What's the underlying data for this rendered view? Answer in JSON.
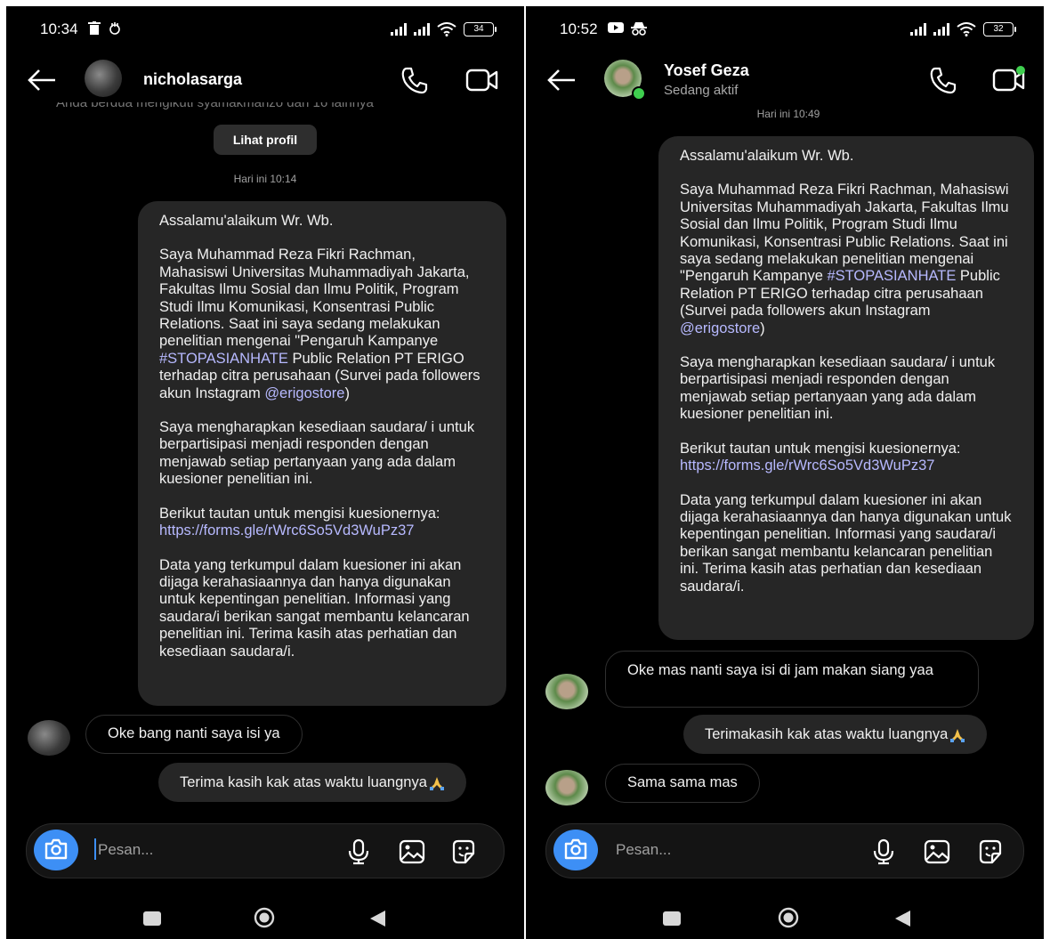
{
  "left": {
    "status": {
      "time": "10:34",
      "battery": "34"
    },
    "contact": {
      "name": "nicholasarga"
    },
    "cutoff_line": "Anda berdua mengikuti syamakmanzo dan 16 lainnya",
    "profile_button": "Lihat profil",
    "timestamp": "Hari ini 10:14",
    "message": {
      "greeting": "Assalamu'alaikum Wr. Wb.",
      "intro_a": "Saya Muhammad Reza Fikri Rachman, Mahasiswi Universitas Muhammadiyah Jakarta, Fakultas Ilmu Sosial dan Ilmu Politik, Program Studi Ilmu Komunikasi, Konsentrasi Public Relations. Saat ini saya sedang melakukan penelitian mengenai \"Pengaruh Kampanye ",
      "hashtag": "#STOPASIANHATE",
      "intro_b": " Public Relation PT ERIGO terhadap citra perusahaan (Survei pada followers akun Instagram ",
      "mention": "@erigostore",
      "intro_c": ")",
      "request": "Saya mengharapkan kesediaan saudara/ i untuk berpartisipasi menjadi responden dengan menjawab setiap pertanyaan yang ada dalam kuesioner penelitian ini.",
      "link_intro": "Berikut tautan untuk mengisi kuesionernya:",
      "link": "https://forms.gle/rWrc6So5Vd3WuPz37",
      "closing": "Data yang terkumpul dalam kuesioner ini akan dijaga kerahasiaannya dan hanya digunakan untuk kepentingan penelitian. Informasi yang saudara/i berikan sangat membantu kelancaran penelitian ini. Terima kasih atas perhatian dan kesediaan saudara/i."
    },
    "reply_1": "Oke bang nanti saya isi ya",
    "sent_2": "Terima kasih kak atas waktu luangnya",
    "composer_placeholder": "Pesan..."
  },
  "right": {
    "status": {
      "time": "10:52",
      "battery": "32"
    },
    "contact": {
      "name": "Yosef Geza",
      "status": "Sedang aktif"
    },
    "timestamp": "Hari ini 10:49",
    "message": {
      "greeting": "Assalamu'alaikum Wr. Wb.",
      "intro_a": "Saya Muhammad Reza Fikri Rachman, Mahasiswi Universitas Muhammadiyah Jakarta, Fakultas Ilmu Sosial dan Ilmu Politik, Program Studi Ilmu Komunikasi, Konsentrasi Public Relations. Saat ini saya sedang melakukan penelitian mengenai \"Pengaruh Kampanye ",
      "hashtag": "#STOPASIANHATE",
      "intro_b": " Public Relation PT ERIGO terhadap citra perusahaan (Survei pada followers akun Instagram ",
      "mention": "@erigostore",
      "intro_c": ")",
      "request": "Saya mengharapkan kesediaan saudara/ i untuk berpartisipasi menjadi responden dengan menjawab setiap pertanyaan yang ada dalam kuesioner penelitian ini.",
      "link_intro": "Berikut tautan untuk mengisi kuesionernya:",
      "link": "https://forms.gle/rWrc6So5Vd3WuPz37",
      "closing": "Data yang terkumpul dalam kuesioner ini akan dijaga kerahasiaannya dan hanya digunakan untuk kepentingan penelitian. Informasi yang saudara/i berikan sangat membantu kelancaran penelitian ini. Terima kasih atas perhatian dan kesediaan saudara/i."
    },
    "reply_1": "Oke mas nanti saya isi di jam makan siang yaa",
    "sent_2": "Terimakasih kak atas waktu luangnya",
    "reply_3": "Sama sama mas",
    "composer_placeholder": "Pesan..."
  },
  "colors": {
    "background": "#000000",
    "bubble": "#262626",
    "link": "#b7b9ff",
    "camera": "#3d8ff5",
    "online": "#3fcf4f"
  },
  "icons": [
    "back-arrow-icon",
    "phone-icon",
    "video-call-icon",
    "camera-icon",
    "microphone-icon",
    "gallery-icon",
    "sticker-icon",
    "folded-hands-emoji-icon"
  ]
}
